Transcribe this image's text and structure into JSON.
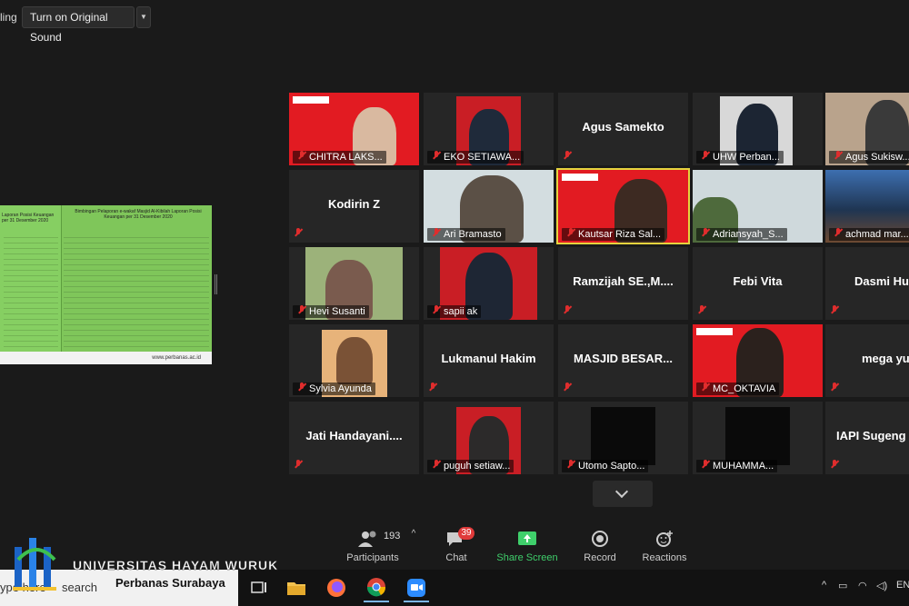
{
  "topbar": {
    "recording_text": "ling",
    "sound_button": "Turn on Original Sound",
    "dropdown": "▼"
  },
  "share": {
    "title": "Bimbingan Pelaporan e-wakaf Masjid Al-Kibilah Laporan Posisi Keuangan per 31 Desember 2020",
    "left_title": "Laporan Posisi Keuangan per 31 Desember 2020",
    "footer": "www.perbanas.ac.id"
  },
  "tiles": [
    {
      "label": "CHITRA LAKS...",
      "name": ""
    },
    {
      "label": "EKO SETIAWA...",
      "name": ""
    },
    {
      "label": "",
      "name": "Agus Samekto"
    },
    {
      "label": "UHW Perban...",
      "name": ""
    },
    {
      "label": "Agus Sukisw...",
      "name": ""
    },
    {
      "label": "",
      "name": "Kodirin Z"
    },
    {
      "label": "Ari Bramasto",
      "name": ""
    },
    {
      "label": "Kautsar Riza Sal...",
      "name": ""
    },
    {
      "label": "Adriansyah_S...",
      "name": ""
    },
    {
      "label": "achmad mar...",
      "name": ""
    },
    {
      "label": "Hevi Susanti",
      "name": ""
    },
    {
      "label": "sapii ak",
      "name": ""
    },
    {
      "label": "",
      "name": "Ramzijah  SE.,M...."
    },
    {
      "label": "",
      "name": "Febi Vita"
    },
    {
      "label": "",
      "name": "Dasmi Hu"
    },
    {
      "label": "Sylvia Ayunda",
      "name": ""
    },
    {
      "label": "",
      "name": "Lukmanul Hakim"
    },
    {
      "label": "",
      "name": "MASJID  BESAR..."
    },
    {
      "label": "MC_OKTAVIA",
      "name": ""
    },
    {
      "label": "",
      "name": "mega yu"
    },
    {
      "label": "",
      "name": "Jati  Handayani...."
    },
    {
      "label": "puguh setiaw...",
      "name": ""
    },
    {
      "label": "Utomo Sapto...",
      "name": ""
    },
    {
      "label": "MUHAMMA...",
      "name": ""
    },
    {
      "label": "",
      "name": "IAPI  Sugeng"
    }
  ],
  "controls": {
    "participants_count": "193",
    "participants": "Participants",
    "chat_badge": "39",
    "chat": "Chat",
    "share_screen": "Share Screen",
    "record": "Record",
    "reactions": "Reactions"
  },
  "overlay": {
    "logo_title": "UNIVERSITAS HAYAM WURUK",
    "logo_subtitle": "Perbanas Surabaya"
  },
  "taskbar": {
    "search_placeholder": "ype here",
    "search_placeholder2": "search",
    "tray_lang": "EN"
  },
  "colors": {
    "share_green": "#7fc65a",
    "active_border": "#e5d33e",
    "muted_red": "#e02d2d",
    "share_screen_green": "#3fcf6b"
  }
}
